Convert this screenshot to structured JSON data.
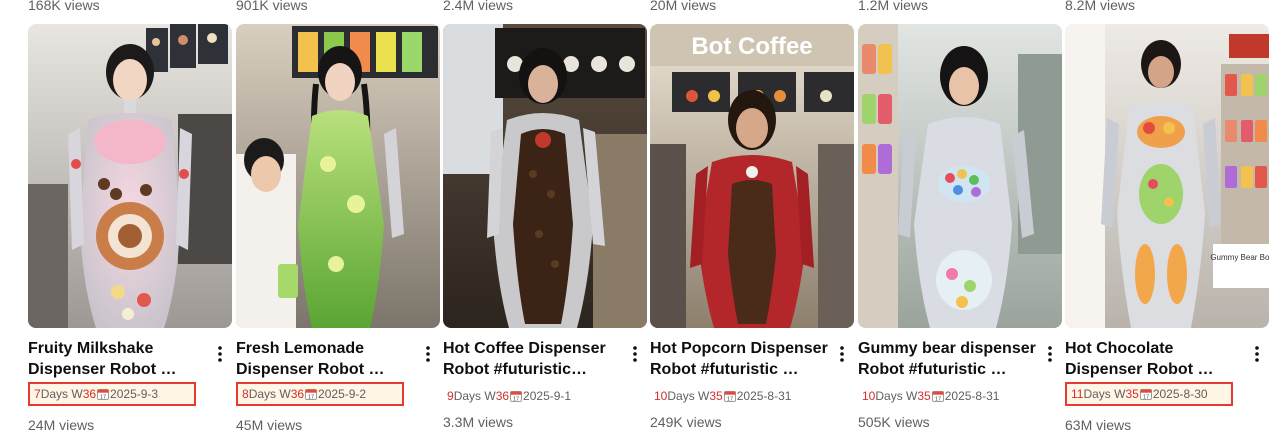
{
  "top_row_views": [
    "168K views",
    "901K views",
    "2.4M views",
    "20M views",
    "1.2M views",
    "8.2M views"
  ],
  "videos": [
    {
      "title": "Fruity Milkshake Dispenser Robot …",
      "days": "7",
      "days_suffix": "Days W",
      "week": "36",
      "date": "2025-9-3",
      "boxed": true,
      "views": "24M views",
      "menu_icon": "more-vertical-icon"
    },
    {
      "title": "Fresh Lemonade Dispenser Robot …",
      "days": "8",
      "days_suffix": "Days W",
      "week": "36",
      "date": "2025-9-2",
      "boxed": true,
      "views": "45M views",
      "menu_icon": "more-vertical-icon"
    },
    {
      "title": "Hot Coffee Dispenser Robot #futuristic #rob…",
      "days": "9",
      "days_suffix": "Days W",
      "week": "36",
      "date": "2025-9-1",
      "boxed": false,
      "views": "3.3M views",
      "menu_icon": "more-vertical-icon"
    },
    {
      "title": "Hot Popcorn Dispenser Robot #futuristic …",
      "days": "10",
      "days_suffix": "Days W",
      "week": "35",
      "date": "2025-8-31",
      "boxed": false,
      "views": "249K views",
      "menu_icon": "more-vertical-icon"
    },
    {
      "title": "Gummy bear dispenser Robot #futuristic …",
      "days": "10",
      "days_suffix": "Days W",
      "week": "35",
      "date": "2025-8-31",
      "boxed": false,
      "views": "505K views",
      "menu_icon": "more-vertical-icon"
    },
    {
      "title": "Hot Chocolate Dispenser Robot …",
      "days": "11",
      "days_suffix": "Days W",
      "week": "35",
      "date": "2025-8-30",
      "boxed": true,
      "views": "63M views",
      "menu_icon": "more-vertical-icon"
    }
  ],
  "thumb_signs": [
    "",
    "",
    "",
    "Bot Coffee",
    "",
    "Gummy Bear Bot"
  ],
  "colors": {
    "text_primary": "#0f0f0f",
    "text_secondary": "#606060",
    "highlight_border": "#e53935",
    "highlight_bg": "#fff6e5"
  }
}
